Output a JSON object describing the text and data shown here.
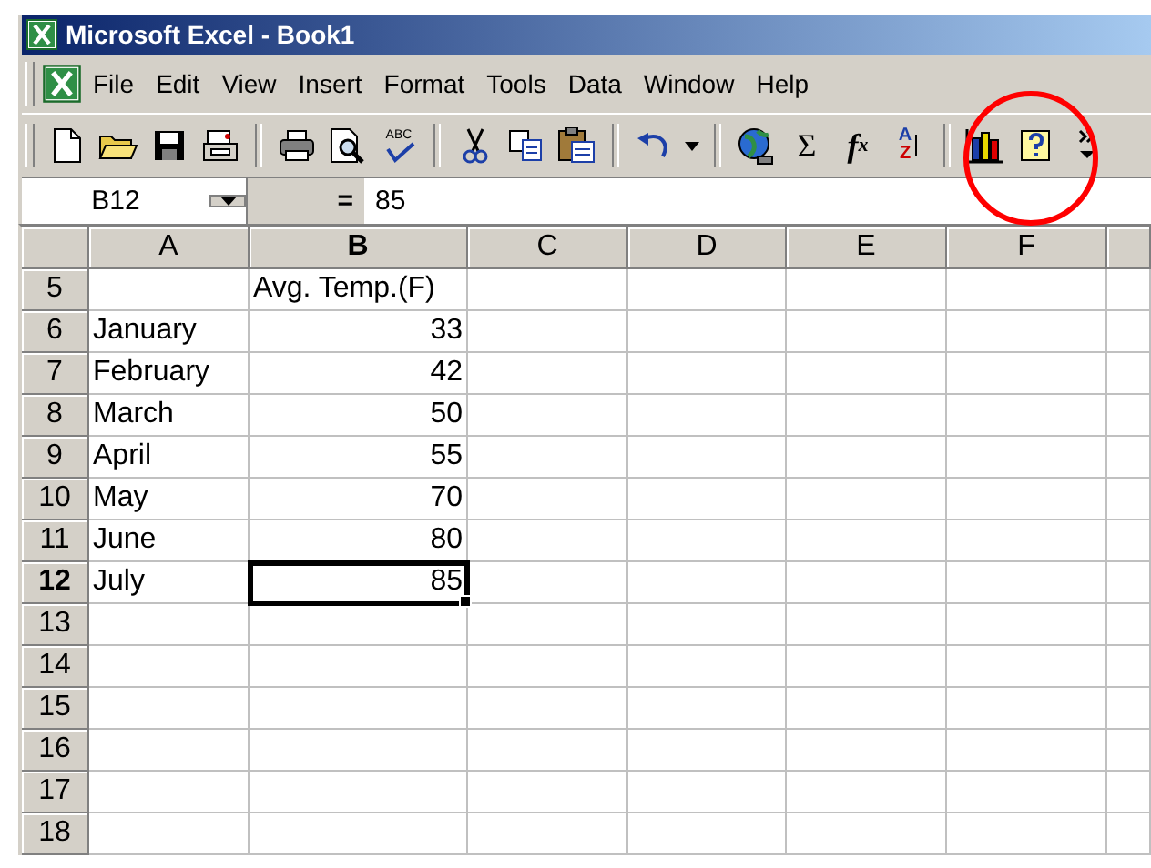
{
  "window": {
    "title": "Microsoft Excel - Book1"
  },
  "menu": [
    "File",
    "Edit",
    "View",
    "Insert",
    "Format",
    "Tools",
    "Data",
    "Window",
    "Help"
  ],
  "toolbar": [
    {
      "kind": "new"
    },
    {
      "kind": "open"
    },
    {
      "kind": "save"
    },
    {
      "kind": "mail"
    },
    {
      "kind": "sep"
    },
    {
      "kind": "print"
    },
    {
      "kind": "preview"
    },
    {
      "kind": "spelling",
      "letters": [
        "ABC"
      ]
    },
    {
      "kind": "sep"
    },
    {
      "kind": "cut"
    },
    {
      "kind": "copy"
    },
    {
      "kind": "paste"
    },
    {
      "kind": "sep"
    },
    {
      "kind": "undo"
    },
    {
      "kind": "dropdown"
    },
    {
      "kind": "sep"
    },
    {
      "kind": "web"
    },
    {
      "kind": "sum",
      "glyph": "Σ"
    },
    {
      "kind": "function",
      "glyph": "f",
      "letters": [
        "x"
      ]
    },
    {
      "kind": "sort",
      "letters": [
        "A",
        "Z"
      ]
    },
    {
      "kind": "sep"
    },
    {
      "kind": "chart"
    },
    {
      "kind": "help"
    },
    {
      "kind": "more"
    }
  ],
  "formula_bar": {
    "name_box": "B12",
    "equals": "=",
    "value": "85"
  },
  "columns": [
    {
      "label": "A",
      "selected": false
    },
    {
      "label": "B",
      "selected": true
    },
    {
      "label": "C",
      "selected": false
    },
    {
      "label": "D",
      "selected": false
    },
    {
      "label": "E",
      "selected": false
    },
    {
      "label": "F",
      "selected": false
    }
  ],
  "rows": [
    {
      "number": "5",
      "selected": false,
      "cells": [
        "",
        "Avg. Temp.(F)"
      ]
    },
    {
      "number": "6",
      "selected": false,
      "cells": [
        "January",
        "33"
      ]
    },
    {
      "number": "7",
      "selected": false,
      "cells": [
        "February",
        "42"
      ]
    },
    {
      "number": "8",
      "selected": false,
      "cells": [
        "March",
        "50"
      ]
    },
    {
      "number": "9",
      "selected": false,
      "cells": [
        "April",
        "55"
      ]
    },
    {
      "number": "10",
      "selected": false,
      "cells": [
        "May",
        "70"
      ]
    },
    {
      "number": "11",
      "selected": false,
      "cells": [
        "June",
        "80"
      ]
    },
    {
      "number": "12",
      "selected": true,
      "cells": [
        "July",
        "85"
      ]
    },
    {
      "number": "13",
      "selected": false,
      "cells": []
    },
    {
      "number": "14",
      "selected": false,
      "cells": []
    },
    {
      "number": "15",
      "selected": false,
      "cells": []
    },
    {
      "number": "16",
      "selected": false,
      "cells": []
    },
    {
      "number": "17",
      "selected": false,
      "cells": []
    },
    {
      "number": "18",
      "selected": false,
      "cells": []
    }
  ],
  "annotation": {
    "kind": "circle"
  }
}
